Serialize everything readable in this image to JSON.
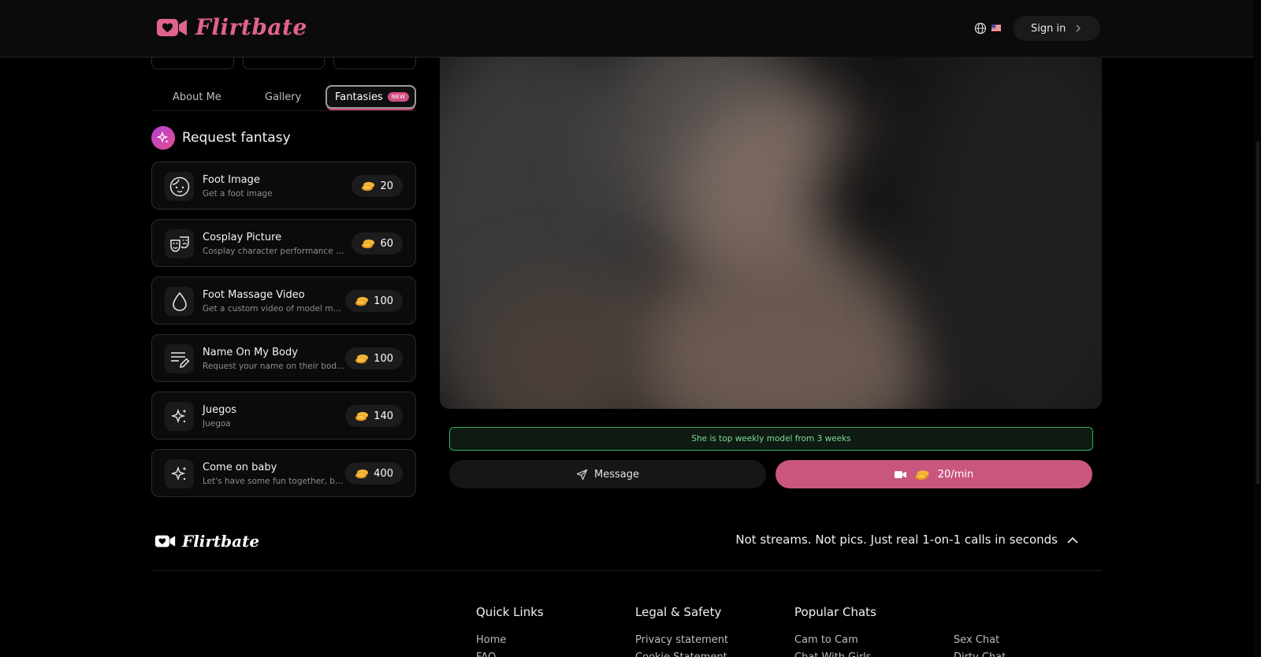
{
  "header": {
    "brand": "Flirtbate",
    "signin_label": "Sign in",
    "globe_icon": "globe-icon",
    "flag_icon": "us-flag-icon"
  },
  "tabs": [
    {
      "label": "About Me",
      "active": false
    },
    {
      "label": "Gallery",
      "active": false
    },
    {
      "label": "Fantasies",
      "active": true,
      "badge": "NEW"
    }
  ],
  "request": {
    "title": "Request fantasy",
    "icon": "sparkles-icon"
  },
  "fantasies": [
    {
      "title": "Foot Image",
      "subtitle": "Get a foot image",
      "price": "20",
      "icon": "face-icon"
    },
    {
      "title": "Cosplay Picture",
      "subtitle": "Cosplay character performance image",
      "price": "60",
      "icon": "masks-icon"
    },
    {
      "title": "Foot Massage Video",
      "subtitle": "Get a custom video of model massaging",
      "price": "100",
      "icon": "droplet-icon"
    },
    {
      "title": "Name On My Body",
      "subtitle": "Request your name on their body written",
      "price": "100",
      "icon": "write-icon"
    },
    {
      "title": "Juegos",
      "subtitle": "Juegoa",
      "price": "140",
      "icon": "sparkle-icon"
    },
    {
      "title": "Come on baby",
      "subtitle": "Let's have some fun together, baby",
      "price": "400",
      "icon": "sparkle-icon"
    }
  ],
  "notice": "She is top weekly model from 3 weeks",
  "actions": {
    "message_label": "Message",
    "call_label": "20/min"
  },
  "footer": {
    "brand": "Flirtbate",
    "tagline": "Not streams. Not pics. Just real 1-on-1 calls in seconds",
    "columns": [
      {
        "title": "Quick Links",
        "links": [
          "Home",
          "FAQ"
        ]
      },
      {
        "title": "Legal & Safety",
        "links": [
          "Privacy statement",
          "Cookie Statement"
        ]
      },
      {
        "title": "Popular Chats",
        "links": [
          "Cam to Cam",
          "Chat With Girls"
        ]
      },
      {
        "title": "",
        "links": [
          "Sex Chat",
          "Dirty Chat"
        ]
      }
    ]
  },
  "colors": {
    "brand": "#e0628f",
    "call_button": "#c9567f",
    "notice_border": "#33b05a"
  }
}
